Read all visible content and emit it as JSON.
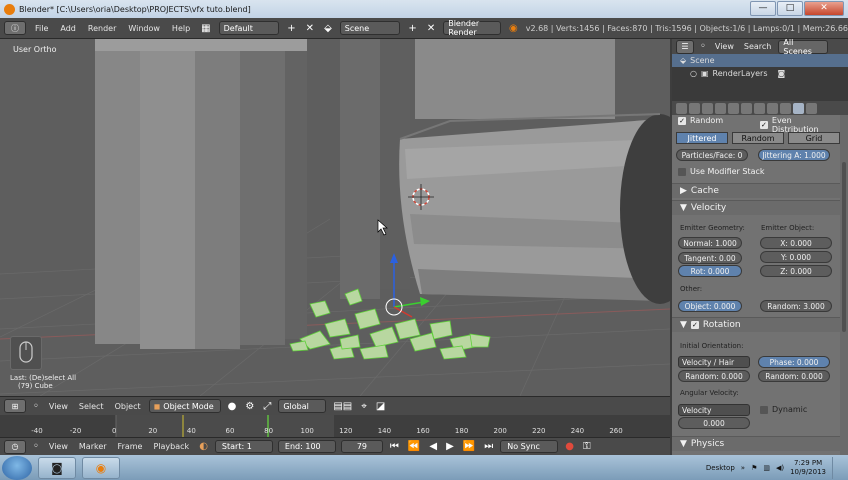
{
  "window": {
    "title": "Blender* [C:\\Users\\oria\\Desktop\\PROJECTS\\vfx tuto.blend]",
    "minimize": "—",
    "maximize": "□",
    "close": "✕"
  },
  "info_header": {
    "menus": [
      "File",
      "Add",
      "Render",
      "Window",
      "Help"
    ],
    "screen_layout": "Default",
    "scene": "Scene",
    "render_engine": "Blender Render",
    "stats": "v2.68 | Verts:1456 | Faces:870 | Tris:1596 | Objects:1/6 | Lamps:0/1 | Mem:26.66"
  },
  "viewport": {
    "view_label": "User Ortho",
    "last_op": "Last: (De)select All",
    "object_label": "(79) Cube"
  },
  "viewport_header": {
    "menus": [
      "View",
      "Select",
      "Object"
    ],
    "mode": "Object Mode",
    "orientation": "Global"
  },
  "timeline": {
    "ticks": [
      "-40",
      "-20",
      "0",
      "20",
      "40",
      "60",
      "80",
      "100",
      "120",
      "140",
      "160",
      "180",
      "200",
      "220",
      "240",
      "260"
    ],
    "menus": [
      "View",
      "Marker",
      "Frame",
      "Playback"
    ],
    "start": "Start: 1",
    "end": "End: 100",
    "current": "79",
    "sync": "No Sync"
  },
  "outliner": {
    "menus": [
      "View",
      "Search"
    ],
    "filter": "All Scenes",
    "rows": [
      "Scene",
      "RenderLayers"
    ]
  },
  "properties": {
    "random_label": "Random",
    "even_distribution_label": "Even Distribution",
    "distribution_tabs": [
      "Jittered",
      "Random",
      "Grid"
    ],
    "particles_face": "Particles/Face: 0",
    "jittering": "Jittering A: 1.000",
    "use_modifier_stack": "Use Modifier Stack",
    "cache_panel": "Cache",
    "velocity_panel": "Velocity",
    "emitter_geometry_label": "Emitter Geometry:",
    "emitter_object_label": "Emitter Object:",
    "normal": "Normal: 1.000",
    "tangent": "Tangent: 0.00",
    "rot": "Rot: 0.000",
    "x": "X: 0.000",
    "y": "Y: 0.000",
    "z": "Z: 0.000",
    "other_label": "Other:",
    "object": "Object: 0.000",
    "random_velocity": "Random: 3.000",
    "rotation_panel": "Rotation",
    "initial_orientation_label": "Initial Orientation:",
    "orientation_dropdown": "Velocity / Hair",
    "phase": "Phase: 0.000",
    "orientation_random": "Random: 0.000",
    "phase_random": "Random: 0.000",
    "angular_velocity_label": "Angular Velocity:",
    "angular_dropdown": "Velocity",
    "dynamic_label": "Dynamic",
    "angular_value": "0.000",
    "physics_panel": "Physics"
  },
  "taskbar": {
    "desktop_label": "Desktop",
    "time": "7:29 PM",
    "date": "10/9/2013"
  }
}
